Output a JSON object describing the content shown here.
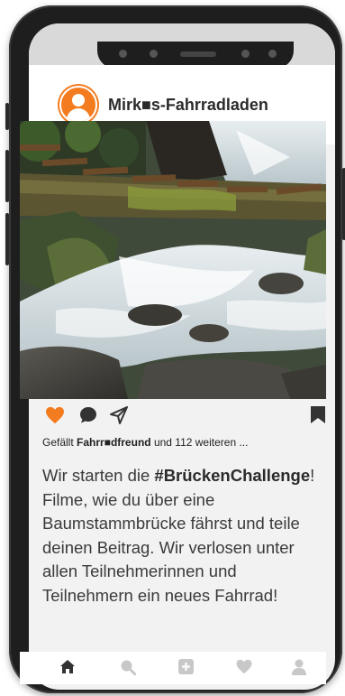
{
  "profile": {
    "name": "Mirk■s-Fahrradladen"
  },
  "post": {
    "likes_prefix": "Gefällt ",
    "likes_user": "Fahrr■dfreund",
    "likes_suffix": " und 112 weiteren ...",
    "caption_before": "Wir starten die ",
    "caption_hashtag": "#BrückenChallenge",
    "caption_after": "! Filme, wie du über eine Baumstammbrücke fährst und teile deinen Beitrag. Wir verlosen unter allen Teilnehmerinnen und Teilnehmern ein neues Fahrrad!",
    "liked": true
  },
  "actions": {
    "like": "heart-icon",
    "comment": "comment-icon",
    "share": "send-icon",
    "save": "bookmark-icon"
  },
  "tabs": [
    {
      "name": "home-icon",
      "active": true
    },
    {
      "name": "search-icon",
      "active": false
    },
    {
      "name": "add-post-icon",
      "active": false
    },
    {
      "name": "activity-heart-icon",
      "active": false
    },
    {
      "name": "profile-icon",
      "active": false
    }
  ],
  "colors": {
    "accent": "#f47c20",
    "icon_dark": "#333333",
    "icon_inactive": "#c8c8c8"
  }
}
